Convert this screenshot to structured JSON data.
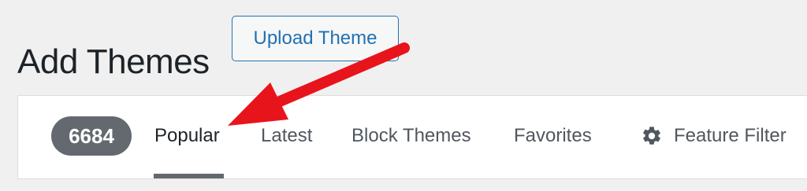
{
  "header": {
    "title": "Add Themes",
    "upload_label": "Upload Theme"
  },
  "filter_bar": {
    "count": "6684",
    "tabs": [
      {
        "label": "Popular",
        "current": true
      },
      {
        "label": "Latest",
        "current": false
      },
      {
        "label": "Block Themes",
        "current": false
      },
      {
        "label": "Favorites",
        "current": false
      }
    ],
    "feature_filter": {
      "icon": "gear-icon",
      "label": "Feature Filter"
    }
  },
  "colors": {
    "accent": "#2271b1",
    "annotation": "#e8141b",
    "badge": "#646970",
    "background": "#f0f0f1"
  }
}
